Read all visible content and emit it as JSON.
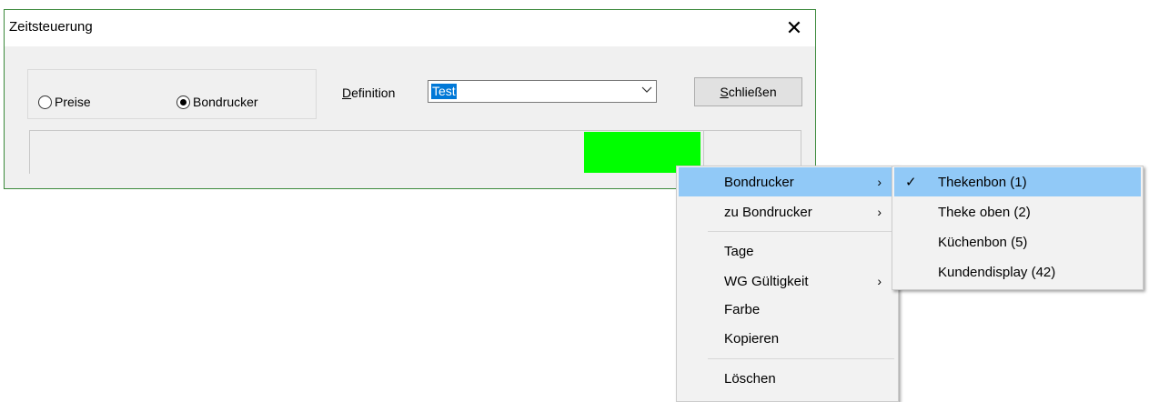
{
  "window": {
    "title": "Zeitsteuerung",
    "close_glyph": "✕"
  },
  "mode": {
    "options": [
      {
        "label": "Preise",
        "selected": false
      },
      {
        "label": "Bondrucker",
        "selected": true
      }
    ]
  },
  "definition": {
    "label_accel": "D",
    "label_rest": "efinition",
    "value": "Test"
  },
  "close_button": {
    "label_accel": "S",
    "label_rest": "chließen"
  },
  "preview": {
    "color": "#00ff00"
  },
  "context_menu": {
    "items": [
      {
        "label": "Bondrucker",
        "submenu": true,
        "highlighted": true
      },
      {
        "label": "zu Bondrucker",
        "submenu": true
      },
      {
        "label": "Tage"
      },
      {
        "label": "WG Gültigkeit",
        "submenu": true
      },
      {
        "label": "Farbe"
      },
      {
        "label": "Kopieren"
      },
      {
        "label": "Löschen"
      }
    ],
    "submenu_glyph": "›"
  },
  "submenu": {
    "items": [
      {
        "label": "Thekenbon (1)",
        "checked": true,
        "highlighted": true
      },
      {
        "label": "Theke oben (2)"
      },
      {
        "label": "Küchenbon (5)"
      },
      {
        "label": "Kundendisplay (42)"
      }
    ],
    "check_glyph": "✓"
  }
}
